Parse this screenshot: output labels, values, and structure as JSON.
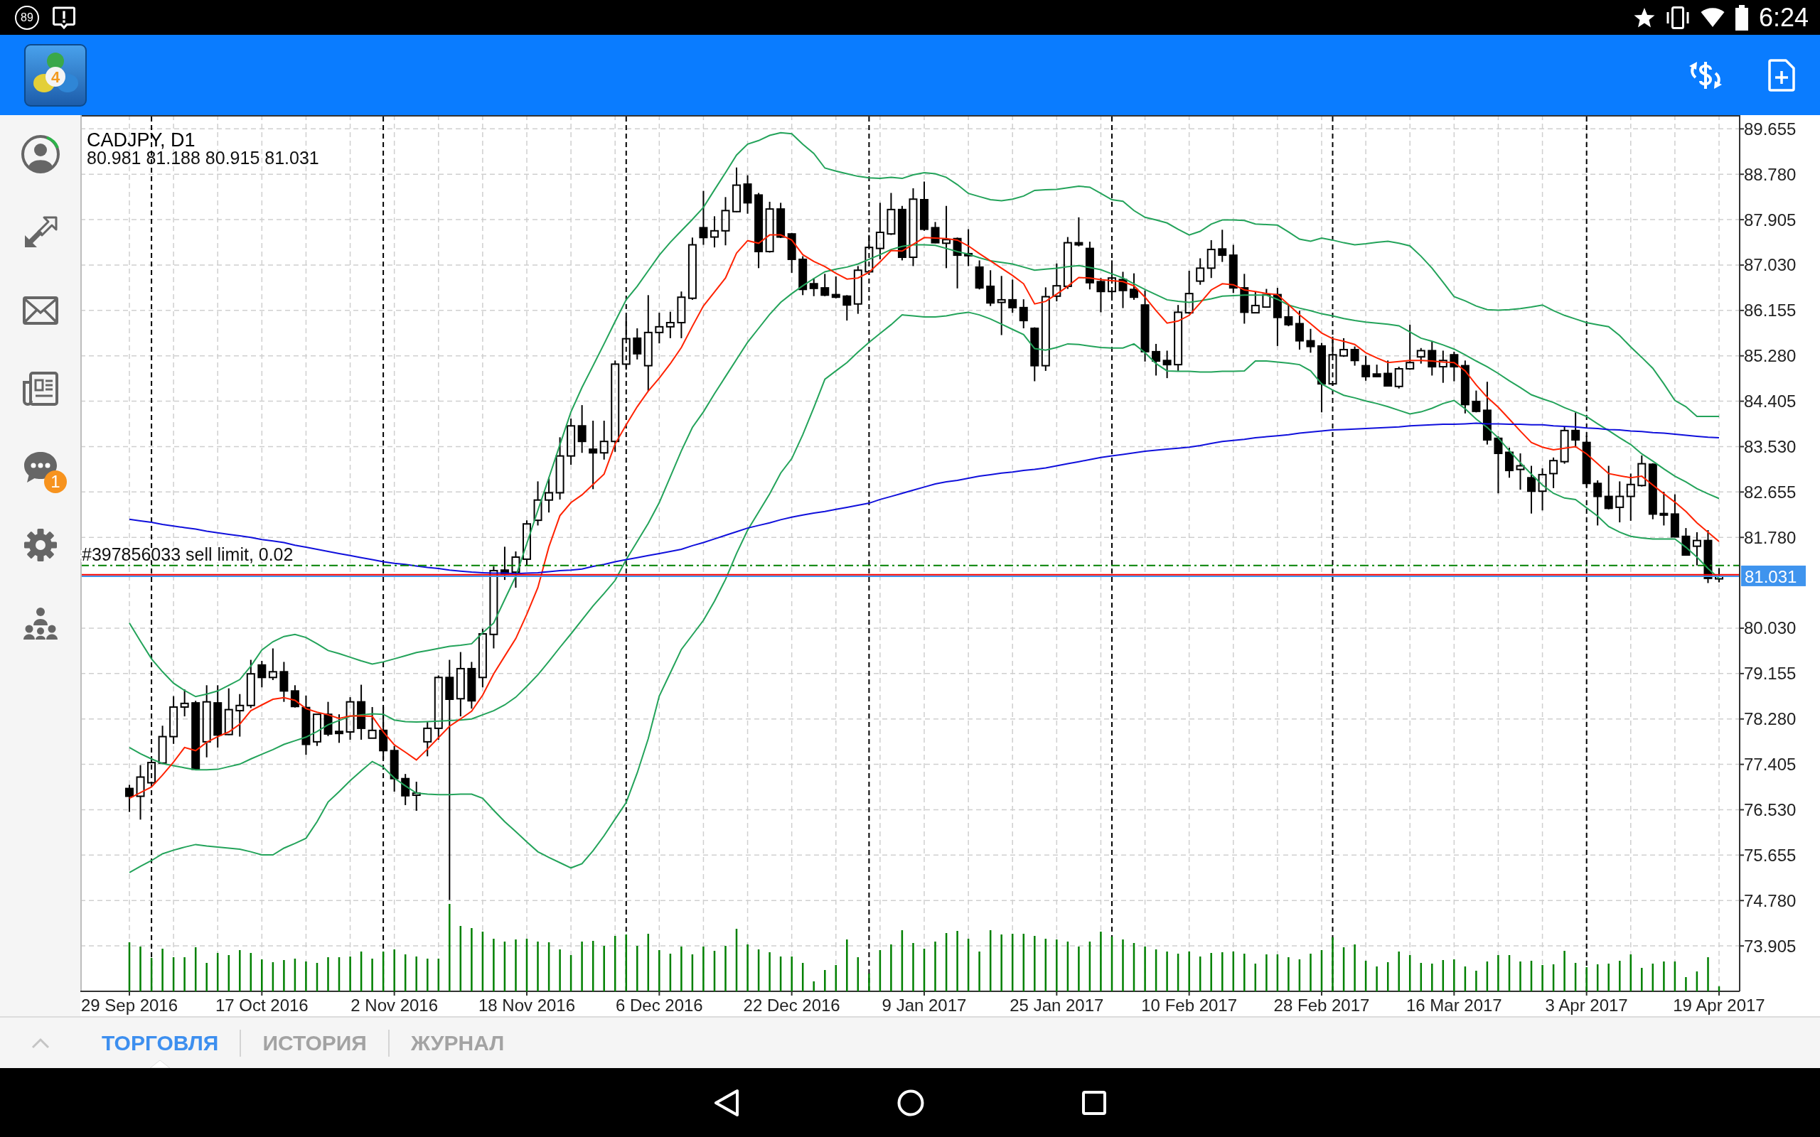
{
  "status_bar": {
    "indicator": "89",
    "time": "6:24"
  },
  "toolbar": {
    "logo_badge": "4"
  },
  "sidebar": {
    "chat_badge": "1"
  },
  "chart": {
    "chart_data": [
      {
        "type": "candlestick",
        "title": "CADJPY, D1",
        "subtitle": "80.981 81.188 80.915 81.031",
        "categories": [
          "29 Sep 2016",
          null,
          null,
          null,
          null,
          null,
          null,
          null,
          null,
          null,
          null,
          null,
          "17 Oct 2016",
          null,
          null,
          null,
          null,
          null,
          null,
          null,
          null,
          null,
          null,
          null,
          "2 Nov 2016",
          null,
          null,
          null,
          null,
          null,
          null,
          null,
          null,
          null,
          null,
          null,
          "18 Nov 2016",
          null,
          null,
          null,
          null,
          null,
          null,
          null,
          null,
          null,
          null,
          null,
          "6 Dec 2016",
          null,
          null,
          null,
          null,
          null,
          null,
          null,
          null,
          null,
          null,
          null,
          "22 Dec 2016",
          null,
          null,
          null,
          null,
          null,
          null,
          null,
          null,
          null,
          null,
          null,
          "9 Jan 2017",
          null,
          null,
          null,
          null,
          null,
          null,
          null,
          null,
          null,
          null,
          null,
          "25 Jan 2017",
          null,
          null,
          null,
          null,
          null,
          null,
          null,
          null,
          null,
          null,
          null,
          "10 Feb 2017",
          null,
          null,
          null,
          null,
          null,
          null,
          null,
          null,
          null,
          null,
          null,
          "28 Feb 2017",
          null,
          null,
          null,
          null,
          null,
          null,
          null,
          null,
          null,
          null,
          null,
          "16 Mar 2017",
          null,
          null,
          null,
          null,
          null,
          null,
          null,
          null,
          null,
          null,
          null,
          "3 Apr 2017",
          null,
          null,
          null,
          null,
          null,
          null,
          null,
          null,
          null,
          null,
          null,
          "19 Apr 2017"
        ],
        "ohlc": [
          [
            76.94,
            77.01,
            76.49,
            76.79
          ],
          [
            76.79,
            77.39,
            76.34,
            77.16
          ],
          [
            77.05,
            77.54,
            77.01,
            77.44
          ],
          [
            77.43,
            78.15,
            77.41,
            77.94
          ],
          [
            77.94,
            78.72,
            77.8,
            78.51
          ],
          [
            78.51,
            78.85,
            78.33,
            78.58
          ],
          [
            78.59,
            78.63,
            77.29,
            77.31
          ],
          [
            77.84,
            78.93,
            77.54,
            78.61
          ],
          [
            78.59,
            78.93,
            77.73,
            77.97
          ],
          [
            77.98,
            78.87,
            77.97,
            78.46
          ],
          [
            78.44,
            78.76,
            77.94,
            78.54
          ],
          [
            78.54,
            79.42,
            78.49,
            79.15
          ],
          [
            79.32,
            79.4,
            78.89,
            79.08
          ],
          [
            79.08,
            79.64,
            79.03,
            79.19
          ],
          [
            79.19,
            79.38,
            78.61,
            78.82
          ],
          [
            78.82,
            78.93,
            78.5,
            78.52
          ],
          [
            78.5,
            78.73,
            77.59,
            77.79
          ],
          [
            77.84,
            78.37,
            77.76,
            78.37
          ],
          [
            78.37,
            78.61,
            77.95,
            77.99
          ],
          [
            78.04,
            78.37,
            77.82,
            78.0
          ],
          [
            78.03,
            78.7,
            77.88,
            78.61
          ],
          [
            78.61,
            78.94,
            77.88,
            78.1
          ],
          [
            77.91,
            78.51,
            77.91,
            78.06
          ],
          [
            78.06,
            78.52,
            77.5,
            77.67
          ],
          [
            77.67,
            77.76,
            76.88,
            77.13
          ],
          [
            77.13,
            77.22,
            76.62,
            76.8
          ],
          [
            76.81,
            77.07,
            76.51,
            76.85
          ],
          [
            77.84,
            78.22,
            77.56,
            78.1
          ],
          [
            78.1,
            79.12,
            77.88,
            79.08
          ],
          [
            79.08,
            79.42,
            74.79,
            78.66
          ],
          [
            78.67,
            79.57,
            78.33,
            79.25
          ],
          [
            79.25,
            79.38,
            78.48,
            78.63
          ],
          [
            79.08,
            80.02,
            78.89,
            79.92
          ],
          [
            79.91,
            81.22,
            79.64,
            81.14
          ],
          [
            81.15,
            81.6,
            80.96,
            81.07
          ],
          [
            81.11,
            81.51,
            80.81,
            81.4
          ],
          [
            81.36,
            82.11,
            81.25,
            82.04
          ],
          [
            82.11,
            82.86,
            82.01,
            82.5
          ],
          [
            82.5,
            82.94,
            82.26,
            82.64
          ],
          [
            82.64,
            83.71,
            82.51,
            83.35
          ],
          [
            83.35,
            84.07,
            83.18,
            83.93
          ],
          [
            83.93,
            84.33,
            83.41,
            83.63
          ],
          [
            83.48,
            84.03,
            82.71,
            83.41
          ],
          [
            83.41,
            84.03,
            83.28,
            83.63
          ],
          [
            83.63,
            85.19,
            83.43,
            85.12
          ],
          [
            85.12,
            86.02,
            85.01,
            85.61
          ],
          [
            85.62,
            85.81,
            85.21,
            85.32
          ],
          [
            85.09,
            86.45,
            84.6,
            85.73
          ],
          [
            85.73,
            86.11,
            85.52,
            85.84
          ],
          [
            85.84,
            86.13,
            85.62,
            85.92
          ],
          [
            85.92,
            86.52,
            85.62,
            86.41
          ],
          [
            86.39,
            87.56,
            86.36,
            87.42
          ],
          [
            87.75,
            88.46,
            87.42,
            87.56
          ],
          [
            87.57,
            87.97,
            87.37,
            87.69
          ],
          [
            87.69,
            88.34,
            87.41,
            88.08
          ],
          [
            88.06,
            88.91,
            88.05,
            88.57
          ],
          [
            88.59,
            88.76,
            88.02,
            88.23
          ],
          [
            88.38,
            88.42,
            86.97,
            87.29
          ],
          [
            87.29,
            88.25,
            87.27,
            88.11
          ],
          [
            88.11,
            88.23,
            87.55,
            87.57
          ],
          [
            87.63,
            87.65,
            86.88,
            87.14
          ],
          [
            87.14,
            87.2,
            86.45,
            86.56
          ],
          [
            86.67,
            86.78,
            86.43,
            86.58
          ],
          [
            86.59,
            86.86,
            86.43,
            86.45
          ],
          [
            86.46,
            86.81,
            86.39,
            86.41
          ],
          [
            86.43,
            86.45,
            85.96,
            86.26
          ],
          [
            86.28,
            87.01,
            86.09,
            86.93
          ],
          [
            86.9,
            87.61,
            86.88,
            87.37
          ],
          [
            87.35,
            88.23,
            87.14,
            87.66
          ],
          [
            87.63,
            88.42,
            87.61,
            88.1
          ],
          [
            88.1,
            88.17,
            87.12,
            87.18
          ],
          [
            87.18,
            88.51,
            87.01,
            88.3
          ],
          [
            88.29,
            88.64,
            87.69,
            87.72
          ],
          [
            87.75,
            87.86,
            87.45,
            87.46
          ],
          [
            87.45,
            88.17,
            86.97,
            87.52
          ],
          [
            87.54,
            87.56,
            86.58,
            87.22
          ],
          [
            87.25,
            87.72,
            87.01,
            87.21
          ],
          [
            86.99,
            87.12,
            86.56,
            86.59
          ],
          [
            86.62,
            86.93,
            86.24,
            86.3
          ],
          [
            86.31,
            86.82,
            85.68,
            86.36
          ],
          [
            86.36,
            86.75,
            86.11,
            86.21
          ],
          [
            86.21,
            86.37,
            85.81,
            85.96
          ],
          [
            85.81,
            85.83,
            84.79,
            85.09
          ],
          [
            85.09,
            86.6,
            84.99,
            86.42
          ],
          [
            86.43,
            87.06,
            86.33,
            86.63
          ],
          [
            86.62,
            87.57,
            86.57,
            87.46
          ],
          [
            87.46,
            87.95,
            87.39,
            87.42
          ],
          [
            87.35,
            87.48,
            86.56,
            86.69
          ],
          [
            86.71,
            86.78,
            86.12,
            86.52
          ],
          [
            86.52,
            87.12,
            86.35,
            86.78
          ],
          [
            86.75,
            86.9,
            86.2,
            86.54
          ],
          [
            86.56,
            86.87,
            86.36,
            86.41
          ],
          [
            86.26,
            86.54,
            85.17,
            85.36
          ],
          [
            85.36,
            85.51,
            84.9,
            85.18
          ],
          [
            85.19,
            85.38,
            84.85,
            85.11
          ],
          [
            85.11,
            86.26,
            84.99,
            86.12
          ],
          [
            86.11,
            86.92,
            86.09,
            86.48
          ],
          [
            86.72,
            87.16,
            86.65,
            86.97
          ],
          [
            86.97,
            87.51,
            86.78,
            87.33
          ],
          [
            87.34,
            87.71,
            87.09,
            87.22
          ],
          [
            87.22,
            87.42,
            86.49,
            86.59
          ],
          [
            86.59,
            86.86,
            85.9,
            86.12
          ],
          [
            86.11,
            86.51,
            86.11,
            86.25
          ],
          [
            86.22,
            86.57,
            86.22,
            86.46
          ],
          [
            86.46,
            86.59,
            85.47,
            86.02
          ],
          [
            86.03,
            86.26,
            85.85,
            85.88
          ],
          [
            85.9,
            86.15,
            85.4,
            85.57
          ],
          [
            85.57,
            85.8,
            85.34,
            85.46
          ],
          [
            85.47,
            85.53,
            84.19,
            84.74
          ],
          [
            84.74,
            85.65,
            84.7,
            85.3
          ],
          [
            85.28,
            85.62,
            85.26,
            85.4
          ],
          [
            85.4,
            85.46,
            85.09,
            85.19
          ],
          [
            85.09,
            85.28,
            84.8,
            84.88
          ],
          [
            84.93,
            85.11,
            84.87,
            84.88
          ],
          [
            84.94,
            85.19,
            84.69,
            84.7
          ],
          [
            84.69,
            85.07,
            84.65,
            85.03
          ],
          [
            85.03,
            85.88,
            85.01,
            85.15
          ],
          [
            85.26,
            85.43,
            85.13,
            85.38
          ],
          [
            85.38,
            85.56,
            84.9,
            85.07
          ],
          [
            85.07,
            85.38,
            84.76,
            85.19
          ],
          [
            85.3,
            85.36,
            84.79,
            85.07
          ],
          [
            85.09,
            85.19,
            84.17,
            84.34
          ],
          [
            84.4,
            84.61,
            84.19,
            84.21
          ],
          [
            84.23,
            84.78,
            83.57,
            83.66
          ],
          [
            83.69,
            83.73,
            82.63,
            83.4
          ],
          [
            83.42,
            83.51,
            82.93,
            83.07
          ],
          [
            83.09,
            83.4,
            82.7,
            83.16
          ],
          [
            82.93,
            83.16,
            82.24,
            82.67
          ],
          [
            82.67,
            83.11,
            82.3,
            82.99
          ],
          [
            83.01,
            83.32,
            82.73,
            83.26
          ],
          [
            83.24,
            83.92,
            83.2,
            83.84
          ],
          [
            83.84,
            84.19,
            83.51,
            83.66
          ],
          [
            83.61,
            83.74,
            82.75,
            82.82
          ],
          [
            82.82,
            82.88,
            82.01,
            82.57
          ],
          [
            82.57,
            83.16,
            82.32,
            82.34
          ],
          [
            82.36,
            82.86,
            82.07,
            82.57
          ],
          [
            82.57,
            83.01,
            82.1,
            82.8
          ],
          [
            82.78,
            83.36,
            82.76,
            83.2
          ],
          [
            83.19,
            83.21,
            82.13,
            82.23
          ],
          [
            82.24,
            82.66,
            82.01,
            82.21
          ],
          [
            82.23,
            82.61,
            81.78,
            81.79
          ],
          [
            81.8,
            81.96,
            81.44,
            81.44
          ],
          [
            81.61,
            81.88,
            81.24,
            81.72
          ],
          [
            81.72,
            81.92,
            80.9,
            80.99
          ],
          [
            80.981,
            81.188,
            80.915,
            81.031
          ]
        ],
        "series": [
          {
            "type": "line",
            "color": "#23a35a",
            "values": [
              80.13,
              79.78,
              79.44,
              79.19,
              78.97,
              78.83,
              78.71,
              78.76,
              78.82,
              78.93,
              79.04,
              79.3,
              79.61,
              79.77,
              79.87,
              79.91,
              79.85,
              79.73,
              79.6,
              79.54,
              79.47,
              79.4,
              79.34,
              79.38,
              79.44,
              79.5,
              79.56,
              79.6,
              79.64,
              79.68,
              79.7,
              79.73,
              79.94,
              80.13,
              80.58,
              81.03,
              81.66,
              82.3,
              82.93,
              83.57,
              84.2,
              84.67,
              85.09,
              85.51,
              85.94,
              86.36,
              86.62,
              86.92,
              87.22,
              87.47,
              87.69,
              87.91,
              88.14,
              88.48,
              88.81,
              89.15,
              89.36,
              89.43,
              89.53,
              89.58,
              89.56,
              89.36,
              89.18,
              88.9,
              88.84,
              88.79,
              88.74,
              88.71,
              88.7,
              88.72,
              88.7,
              88.77,
              88.81,
              88.79,
              88.72,
              88.58,
              88.41,
              88.35,
              88.29,
              88.27,
              88.3,
              88.36,
              88.47,
              88.48,
              88.49,
              88.52,
              88.55,
              88.53,
              88.41,
              88.29,
              88.26,
              88.08,
              87.95,
              87.9,
              87.84,
              87.72,
              87.61,
              87.68,
              87.82,
              87.9,
              87.9,
              87.89,
              87.82,
              87.81,
              87.8,
              87.67,
              87.53,
              87.49,
              87.55,
              87.51,
              87.46,
              87.42,
              87.44,
              87.47,
              87.49,
              87.45,
              87.4,
              87.2,
              86.97,
              86.7,
              86.42,
              86.34,
              86.24,
              86.17,
              86.16,
              86.17,
              86.19,
              86.22,
              86.26,
              86.15,
              86.06,
              85.99,
              85.92,
              85.88,
              85.84,
              85.67,
              85.45,
              85.25,
              85.04,
              84.74,
              84.42,
              84.3,
              84.11,
              84.11,
              84.11
            ]
          },
          {
            "type": "line",
            "color": "#23a35a",
            "values": [
              77.73,
              77.61,
              77.51,
              77.42,
              77.38,
              77.34,
              77.3,
              77.3,
              77.31,
              77.36,
              77.41,
              77.51,
              77.6,
              77.69,
              77.79,
              77.86,
              77.93,
              78.04,
              78.17,
              78.25,
              78.33,
              78.36,
              78.38,
              78.37,
              78.26,
              78.23,
              78.22,
              78.23,
              78.24,
              78.25,
              78.26,
              78.28,
              78.36,
              78.44,
              78.55,
              78.7,
              78.91,
              79.13,
              79.39,
              79.66,
              79.92,
              80.19,
              80.46,
              80.7,
              80.95,
              81.35,
              81.7,
              82.05,
              82.45,
              82.95,
              83.45,
              83.9,
              84.2,
              84.55,
              84.88,
              85.21,
              85.54,
              85.81,
              86.08,
              86.31,
              86.48,
              86.63,
              86.77,
              86.9,
              86.95,
              86.99,
              87.05,
              87.14,
              87.23,
              87.33,
              87.39,
              87.42,
              87.42,
              87.41,
              87.35,
              87.29,
              87.24,
              87.17,
              87.11,
              87.08,
              87.05,
              86.99,
              86.93,
              86.95,
              86.97,
              87.0,
              87.02,
              86.98,
              86.94,
              86.86,
              86.78,
              86.67,
              86.56,
              86.46,
              86.36,
              86.33,
              86.31,
              86.34,
              86.38,
              86.43,
              86.44,
              86.45,
              86.45,
              86.45,
              86.37,
              86.26,
              86.2,
              86.15,
              86.09,
              86.05,
              86.0,
              85.96,
              85.93,
              85.91,
              85.89,
              85.86,
              85.74,
              85.62,
              85.56,
              85.49,
              85.41,
              85.3,
              85.18,
              85.07,
              84.94,
              84.8,
              84.67,
              84.53,
              84.45,
              84.38,
              84.28,
              84.2,
              84.11,
              83.97,
              83.84,
              83.7,
              83.57,
              83.39,
              83.25,
              83.1,
              82.96,
              82.85,
              82.72,
              82.62,
              82.53
            ]
          },
          {
            "type": "line",
            "color": "#23a35a",
            "values": [
              75.32,
              75.44,
              75.55,
              75.68,
              75.75,
              75.81,
              75.86,
              75.83,
              75.81,
              75.79,
              75.77,
              75.72,
              75.66,
              75.66,
              75.79,
              75.88,
              75.98,
              76.3,
              76.68,
              76.88,
              77.09,
              77.28,
              77.46,
              77.35,
              77.14,
              76.99,
              76.85,
              76.83,
              76.82,
              76.82,
              76.83,
              76.83,
              76.75,
              76.52,
              76.3,
              76.11,
              75.91,
              75.72,
              75.61,
              75.51,
              75.41,
              75.49,
              75.74,
              76.03,
              76.35,
              76.67,
              77.24,
              77.9,
              78.72,
              79.17,
              79.62,
              79.9,
              80.18,
              80.55,
              80.97,
              81.47,
              81.92,
              82.27,
              82.62,
              83.02,
              83.3,
              83.76,
              84.28,
              84.83,
              84.99,
              85.15,
              85.35,
              85.54,
              85.71,
              85.88,
              86.07,
              86.05,
              86.03,
              86.03,
              86.05,
              86.09,
              86.12,
              86.07,
              85.99,
              85.89,
              85.79,
              85.69,
              85.42,
              85.39,
              85.44,
              85.51,
              85.5,
              85.47,
              85.44,
              85.43,
              85.43,
              85.51,
              85.34,
              85.13,
              84.99,
              84.98,
              84.98,
              84.97,
              84.97,
              84.98,
              84.98,
              84.99,
              85.18,
              85.18,
              85.16,
              85.14,
              85.11,
              84.99,
              84.74,
              84.62,
              84.52,
              84.47,
              84.41,
              84.36,
              84.3,
              84.23,
              84.16,
              84.2,
              84.27,
              84.36,
              84.42,
              84.26,
              84.06,
              83.9,
              83.7,
              83.45,
              83.22,
              83.0,
              82.79,
              82.63,
              82.54,
              82.51,
              82.35,
              82.19,
              81.99,
              81.88,
              81.8,
              81.77,
              81.75,
              81.75,
              81.75,
              81.59,
              81.4,
              81.18,
              80.99
            ]
          },
          {
            "type": "line",
            "color": "#ff2200",
            "values": [
              76.75,
              76.86,
              76.97,
              77.2,
              77.45,
              77.73,
              77.67,
              77.83,
              77.94,
              78.03,
              78.18,
              78.44,
              78.55,
              78.66,
              78.69,
              78.64,
              78.48,
              78.41,
              78.36,
              78.29,
              78.34,
              78.34,
              78.33,
              78.03,
              77.78,
              77.64,
              77.49,
              77.7,
              77.92,
              78.14,
              78.28,
              78.43,
              78.74,
              79.15,
              79.49,
              79.83,
              80.3,
              80.81,
              81.6,
              82.2,
              82.45,
              82.6,
              82.8,
              83.0,
              83.58,
              83.95,
              84.3,
              84.6,
              84.85,
              85.13,
              85.44,
              85.85,
              86.24,
              86.51,
              86.78,
              87.26,
              87.5,
              87.45,
              87.61,
              87.61,
              87.51,
              87.23,
              87.1,
              87.0,
              86.87,
              86.76,
              86.78,
              86.89,
              87.09,
              87.31,
              87.3,
              87.43,
              87.56,
              87.55,
              87.54,
              87.51,
              87.4,
              87.25,
              87.11,
              86.97,
              86.83,
              86.67,
              86.28,
              86.33,
              86.47,
              86.62,
              86.79,
              86.78,
              86.75,
              86.73,
              86.71,
              86.63,
              86.41,
              86.15,
              85.91,
              85.95,
              86.06,
              86.3,
              86.55,
              86.67,
              86.65,
              86.55,
              86.52,
              86.48,
              86.46,
              86.27,
              86.07,
              85.9,
              85.72,
              85.61,
              85.56,
              85.5,
              85.34,
              85.24,
              85.15,
              85.17,
              85.19,
              85.19,
              85.18,
              85.16,
              85.15,
              84.99,
              84.72,
              84.48,
              84.29,
              84.06,
              83.83,
              83.61,
              83.52,
              83.47,
              83.5,
              83.53,
              83.39,
              83.2,
              83.01,
              82.97,
              82.93,
              82.96,
              82.79,
              82.62,
              82.46,
              82.28,
              82.06,
              81.88,
              81.7
            ]
          },
          {
            "type": "line",
            "color": "#1010dc",
            "values": [
              82.13,
              82.1,
              82.07,
              82.03,
              82.0,
              81.97,
              81.94,
              81.9,
              81.87,
              81.84,
              81.81,
              81.78,
              81.74,
              81.71,
              81.68,
              81.63,
              81.59,
              81.55,
              81.51,
              81.47,
              81.43,
              81.39,
              81.35,
              81.31,
              81.28,
              81.26,
              81.23,
              81.2,
              81.18,
              81.15,
              81.13,
              81.11,
              81.1,
              81.09,
              81.09,
              81.08,
              81.09,
              81.1,
              81.12,
              81.14,
              81.15,
              81.17,
              81.22,
              81.26,
              81.31,
              81.35,
              81.39,
              81.43,
              81.47,
              81.51,
              81.55,
              81.62,
              81.68,
              81.75,
              81.82,
              81.89,
              81.96,
              82.01,
              82.06,
              82.12,
              82.17,
              82.21,
              82.25,
              82.28,
              82.32,
              82.36,
              82.4,
              82.44,
              82.51,
              82.57,
              82.63,
              82.69,
              82.75,
              82.81,
              82.85,
              82.88,
              82.92,
              82.96,
              82.99,
              83.02,
              83.04,
              83.07,
              83.09,
              83.12,
              83.16,
              83.2,
              83.24,
              83.28,
              83.32,
              83.35,
              83.38,
              83.41,
              83.44,
              83.46,
              83.48,
              83.5,
              83.52,
              83.55,
              83.59,
              83.63,
              83.65,
              83.67,
              83.7,
              83.72,
              83.74,
              83.76,
              83.79,
              83.81,
              83.83,
              83.85,
              83.86,
              83.87,
              83.88,
              83.89,
              83.9,
              83.91,
              83.93,
              83.94,
              83.95,
              83.96,
              83.96,
              83.97,
              83.98,
              83.97,
              83.97,
              83.96,
              83.96,
              83.95,
              83.95,
              83.93,
              83.92,
              83.91,
              83.89,
              83.88,
              83.86,
              83.85,
              83.83,
              83.82,
              83.8,
              83.79,
              83.77,
              83.75,
              83.73,
              83.71,
              83.7
            ]
          }
        ],
        "ylim": [
          73.03,
          89.92
        ],
        "yticks": [
          89.655,
          {
            "value": 88.78,
            "label": "88.780"
          },
          87.905,
          {
            "value": 87.03,
            "label": "87.030"
          },
          86.155,
          {
            "value": 85.28,
            "label": "85.280"
          },
          84.405,
          {
            "value": 83.53,
            "label": "83.530"
          },
          82.655,
          {
            "value": 81.78,
            "label": "81.780"
          },
          {
            "value": 80.03,
            "label": "80.030"
          },
          79.155,
          {
            "value": 78.28,
            "label": "78.280"
          },
          77.405,
          {
            "value": 76.53,
            "label": "76.530"
          },
          75.655,
          {
            "value": 74.78,
            "label": "74.780"
          },
          73.905
        ],
        "grid": true,
        "ref_lines": [
          {
            "axis": "y",
            "value": 81.24,
            "label": "#397856033 sell limit, 0.02",
            "color": "#008000",
            "line_style": "dashdot"
          },
          {
            "axis": "y",
            "value": 81.06,
            "color": "#ff0000",
            "line_style": "solid"
          },
          {
            "axis": "y",
            "value": 81.031,
            "label": "81.031",
            "color": "#3f94ee",
            "line_style": "solid"
          }
        ]
      }
    ]
  },
  "bottom_tabs": [
    {
      "label": "ТОРГОВЛЯ",
      "selected": true
    },
    {
      "label": "ИСТОРИЯ",
      "selected": false
    },
    {
      "label": "ЖУРНАЛ",
      "selected": false
    }
  ]
}
